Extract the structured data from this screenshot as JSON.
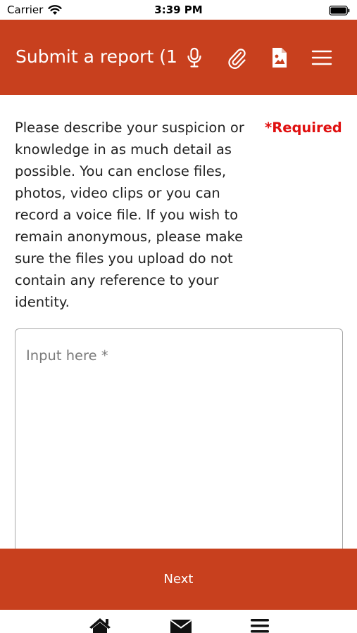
{
  "status_bar": {
    "carrier": "Carrier",
    "time": "3:39 PM"
  },
  "header": {
    "title": "Submit a report (1",
    "icons": [
      "microphone-icon",
      "paperclip-icon",
      "image-file-icon",
      "hamburger-menu-icon"
    ],
    "background_color": "#c8401e"
  },
  "form": {
    "description": "Please describe your suspicion or knowledge in as much detail as possible. You can enclose files, photos, video clips or you can record a voice file. If you wish to remain anonymous, please make sure the files you upload do not contain any reference to your identity.",
    "required_label": "*Required",
    "input_placeholder": "Input here *",
    "input_value": ""
  },
  "actions": {
    "next_label": "Next"
  },
  "tab_bar": {
    "icons": [
      "home-icon",
      "mail-icon",
      "menu-icon"
    ]
  },
  "colors": {
    "accent": "#c8401e",
    "required": "#e01010"
  }
}
